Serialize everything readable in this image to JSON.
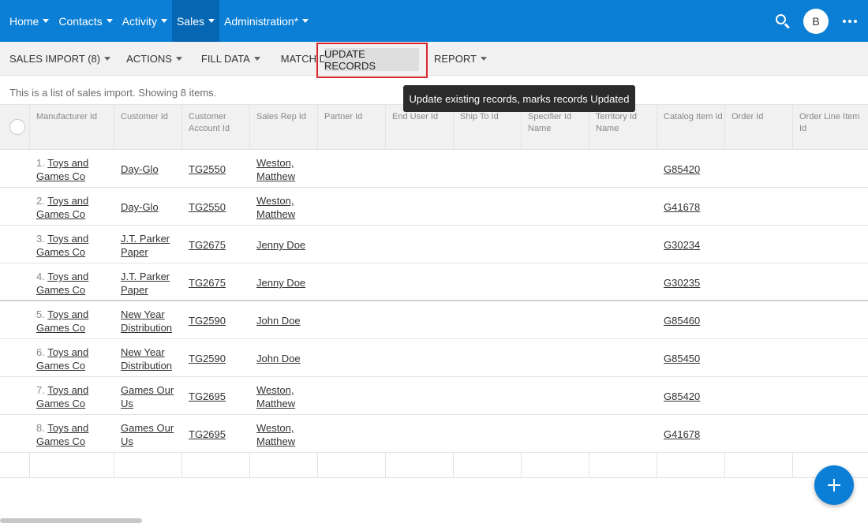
{
  "nav": {
    "items": [
      {
        "label": "Home"
      },
      {
        "label": "Contacts"
      },
      {
        "label": "Activity"
      },
      {
        "label": "Sales"
      },
      {
        "label": "Administration*"
      }
    ],
    "avatar_initial": "B"
  },
  "toolbar": {
    "sales_import": "SALES IMPORT (8)",
    "actions": "ACTIONS",
    "fill_data": "FILL DATA",
    "match_data": "MATCH DATA",
    "update_records": "UPDATE RECORDS",
    "report": "REPORT"
  },
  "tooltip": "Update existing records, marks records Updated",
  "info": "This is a list of sales import. Showing 8 items.",
  "table": {
    "headers": [
      "Manufacturer Id",
      "Customer Id",
      "Customer Account Id",
      "Sales Rep Id",
      "Partner Id",
      "End User Id",
      "Ship To Id",
      "Specifier Id Name",
      "Territory Id Name",
      "Catalog Item Id",
      "Order Id",
      "Order Line Item Id"
    ],
    "rows": [
      {
        "num": "1.",
        "mfr1": "Toys and",
        "mfr2": "Games Co",
        "cust1": "Day-Glo",
        "cust2": "",
        "acct": "TG2550",
        "rep1": "Weston,",
        "rep2": "Matthew",
        "catalog": "G85420"
      },
      {
        "num": "2.",
        "mfr1": "Toys and",
        "mfr2": "Games Co",
        "cust1": "Day-Glo",
        "cust2": "",
        "acct": "TG2550",
        "rep1": "Weston,",
        "rep2": "Matthew",
        "catalog": "G41678"
      },
      {
        "num": "3.",
        "mfr1": "Toys and",
        "mfr2": "Games Co",
        "cust1": "J.T. Parker",
        "cust2": "Paper",
        "acct": "TG2675",
        "rep1": "Jenny Doe",
        "rep2": "",
        "catalog": "G30234"
      },
      {
        "num": "4.",
        "mfr1": "Toys and",
        "mfr2": "Games Co",
        "cust1": "J.T. Parker",
        "cust2": "Paper",
        "acct": "TG2675",
        "rep1": "Jenny Doe",
        "rep2": "",
        "catalog": "G30235"
      },
      {
        "num": "5.",
        "mfr1": "Toys and",
        "mfr2": "Games Co",
        "cust1": "New Year",
        "cust2": "Distribution",
        "acct": "TG2590",
        "rep1": "John Doe",
        "rep2": "",
        "catalog": "G85460"
      },
      {
        "num": "6.",
        "mfr1": "Toys and",
        "mfr2": "Games Co",
        "cust1": "New Year",
        "cust2": "Distribution",
        "acct": "TG2590",
        "rep1": "John Doe",
        "rep2": "",
        "catalog": "G85450"
      },
      {
        "num": "7.",
        "mfr1": "Toys and",
        "mfr2": "Games Co",
        "cust1": "Games Our",
        "cust2": "Us",
        "acct": "TG2695",
        "rep1": "Weston,",
        "rep2": "Matthew",
        "catalog": "G85420"
      },
      {
        "num": "8.",
        "mfr1": "Toys and",
        "mfr2": "Games Co",
        "cust1": "Games Our",
        "cust2": "Us",
        "acct": "TG2695",
        "rep1": "Weston,",
        "rep2": "Matthew",
        "catalog": "G41678"
      }
    ]
  },
  "colors": {
    "primary": "#0a7fd5",
    "highlight": "#d9262c",
    "tooltip_bg": "#2b2b2b"
  }
}
